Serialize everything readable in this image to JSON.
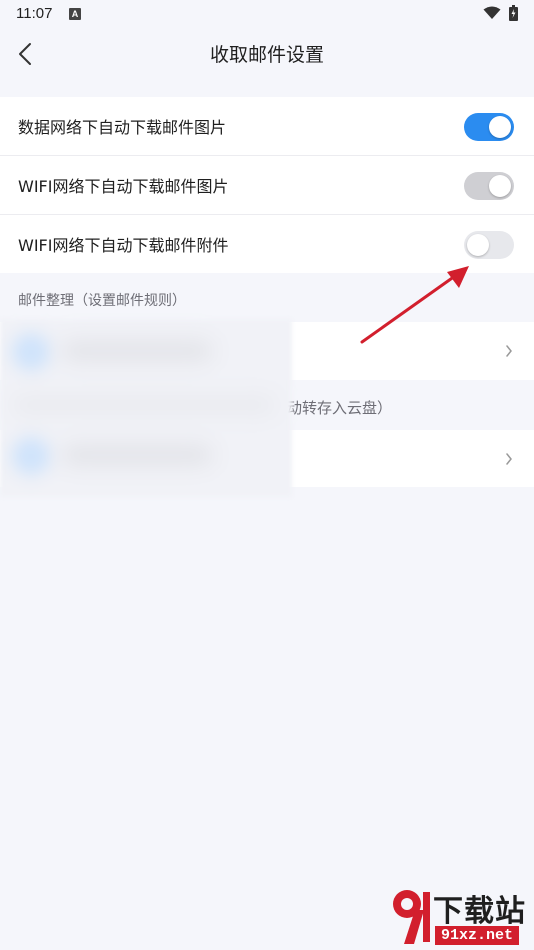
{
  "status_bar": {
    "time": "11:07",
    "notification_badge": "A",
    "icons": [
      "wifi-icon",
      "battery-icon"
    ]
  },
  "nav": {
    "title": "收取邮件设置",
    "back_icon": "chevron-left-icon"
  },
  "settings": [
    {
      "label": "数据网络下自动下载邮件图片",
      "state": "on"
    },
    {
      "label": "WIFI网络下自动下载邮件图片",
      "state": "off-grey"
    },
    {
      "label": "WIFI网络下自动下载邮件附件",
      "state": "off"
    }
  ],
  "section_mail_organize": {
    "label": "邮件整理（设置邮件规则）"
  },
  "blurred_section": {
    "partial_text": "动转存入云盘）"
  },
  "colors": {
    "accent": "#2b8cf0",
    "background": "#f5f6fb",
    "card": "#ffffff",
    "arrow": "#d21f2d"
  },
  "watermark": {
    "title": "下载站",
    "url": "91xz.net"
  }
}
